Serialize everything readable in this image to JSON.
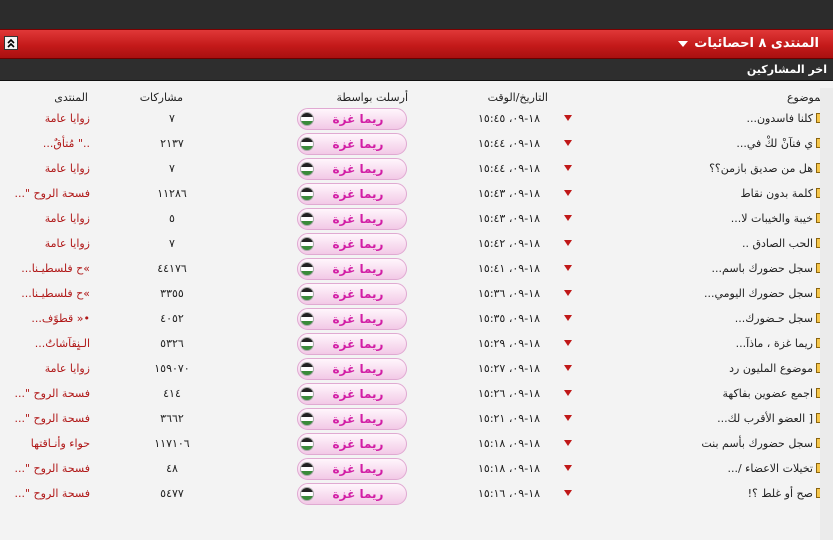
{
  "header": {
    "title": "المنتدى ٨ احصائيات",
    "subtitle": "اخر المشاركين"
  },
  "columns": {
    "topic": "الموضوع",
    "datetime": "التاريخ/الوقت",
    "sent_by": "أرسلت بواسطة",
    "posts": "مشاركات",
    "forum": "المنتدى"
  },
  "rows": [
    {
      "topic": "كلنا فاسدون...",
      "datetime": "١٨-٠٩، ١٥:٤٥",
      "user": "ريما غزة",
      "posts": "٧",
      "forum": "زوايا عامة"
    },
    {
      "topic": "ي فنآنْ لكْ في...",
      "datetime": "١٨-٠٩، ١٥:٤٤",
      "user": "ريما غزة",
      "posts": "٢١٣٧",
      "forum": "..\" مُتأقٌ..."
    },
    {
      "topic": "هل من صديق بازمن؟؟",
      "datetime": "١٨-٠٩، ١٥:٤٤",
      "user": "ريما غزة",
      "posts": "٧",
      "forum": "زوايا عامة"
    },
    {
      "topic": "كلمة بدون نقاط",
      "datetime": "١٨-٠٩، ١٥:٤٣",
      "user": "ريما غزة",
      "posts": "١١٢٨٦",
      "forum": "فسحة الروح \"..."
    },
    {
      "topic": "خيبة والخيبات لا...",
      "datetime": "١٨-٠٩، ١٥:٤٣",
      "user": "ريما غزة",
      "posts": "٥",
      "forum": "زوايا عامة"
    },
    {
      "topic": "الحب الصادق ..",
      "datetime": "١٨-٠٩، ١٥:٤٢",
      "user": "ريما غزة",
      "posts": "٧",
      "forum": "زوايا عامة"
    },
    {
      "topic": "سجل حضورك باسم...",
      "datetime": "١٨-٠٩، ١٥:٤١",
      "user": "ريما غزة",
      "posts": "٤٤١٧٦",
      "forum": "»ح فلسطيـنا..."
    },
    {
      "topic": "سجل حضورك اليومي...",
      "datetime": "١٨-٠٩، ١٥:٣٦",
      "user": "ريما غزة",
      "posts": "٣٣٥٥",
      "forum": "»ح فلسطيـنا..."
    },
    {
      "topic": "سجل حـضورك...",
      "datetime": "١٨-٠٩، ١٥:٣٥",
      "user": "ريما غزة",
      "posts": "٤٠٥٢",
      "forum": "•« قطوًف..."
    },
    {
      "topic": "ريما غزة ، ماذآ...",
      "datetime": "١٨-٠٩، ١٥:٢٩",
      "user": "ريما غزة",
      "posts": "٥٣٢٦",
      "forum": "الـنٍقآشاتُ..."
    },
    {
      "topic": "موضوع المليون رد",
      "datetime": "١٨-٠٩، ١٥:٢٧",
      "user": "ريما غزة",
      "posts": "١٥٩٠٧٠",
      "forum": "زوايا عامة"
    },
    {
      "topic": "اجمع عضوين بفاكهة",
      "datetime": "١٨-٠٩، ١٥:٢٦",
      "user": "ريما غزة",
      "posts": "٤١٤",
      "forum": "فسحة الروح \"..."
    },
    {
      "topic": "[ العضو الأقرب لك...",
      "datetime": "١٨-٠٩، ١٥:٢١",
      "user": "ريما غزة",
      "posts": "٣٦٦٢",
      "forum": "فسحة الروح \"..."
    },
    {
      "topic": "سجل حضورك بأسم بنت",
      "datetime": "١٨-٠٩، ١٥:١٨",
      "user": "ريما غزة",
      "posts": "١١٧١٠٦",
      "forum": "حواء وأنـاقتها"
    },
    {
      "topic": "تخيلات الاعضاء /...",
      "datetime": "١٨-٠٩، ١٥:١٨",
      "user": "ريما غزة",
      "posts": "٤٨",
      "forum": "فسحة الروح \"..."
    },
    {
      "topic": "صح أو غلط ؟!",
      "datetime": "١٨-٠٩، ١٥:١٦",
      "user": "ريما غزة",
      "posts": "٥٤٧٧",
      "forum": "فسحة الروح \"..."
    }
  ]
}
